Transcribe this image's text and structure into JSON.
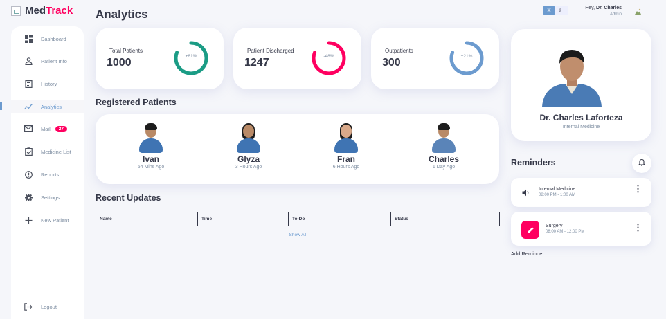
{
  "brand": {
    "prefix": "Med",
    "accent": "Track"
  },
  "page_title": "Analytics",
  "sidebar": {
    "items": [
      {
        "label": "Dashboard",
        "icon": "grid-icon"
      },
      {
        "label": "Patient Info",
        "icon": "person-icon"
      },
      {
        "label": "History",
        "icon": "receipt-icon"
      },
      {
        "label": "Analytics",
        "icon": "insights-icon",
        "active": true
      },
      {
        "label": "Mail",
        "icon": "mail-icon",
        "badge": "27"
      },
      {
        "label": "Medicine List",
        "icon": "inventory-icon"
      },
      {
        "label": "Reports",
        "icon": "report-icon"
      },
      {
        "label": "Settings",
        "icon": "settings-icon"
      },
      {
        "label": "New Patient",
        "icon": "add-icon"
      }
    ],
    "logout": "Logout"
  },
  "stats": [
    {
      "label": "Total Patients",
      "value": "1000",
      "pct_text": "+81%",
      "pct": 0.81,
      "color": "#1b9c85"
    },
    {
      "label": "Patient Discharged",
      "value": "1247",
      "pct_text": "-48%",
      "pct": 0.81,
      "color": "#ff0060"
    },
    {
      "label": "Outpatients",
      "value": "300",
      "pct_text": "+21%",
      "pct": 0.81,
      "color": "#6c9bcf"
    }
  ],
  "registered": {
    "title": "Registered Patients",
    "patients": [
      {
        "name": "Ivan",
        "time": "54 Mins Ago"
      },
      {
        "name": "Glyza",
        "time": "3 Hours Ago"
      },
      {
        "name": "Fran",
        "time": "6 Hours Ago"
      },
      {
        "name": "Charles",
        "time": "1 Day Ago"
      }
    ]
  },
  "recent": {
    "title": "Recent Updates",
    "columns": [
      "Name",
      "Time",
      "To-Do",
      "Status"
    ],
    "show_all": "Show All"
  },
  "header": {
    "greeting": "Hey,",
    "user": "Dr. Charles",
    "role": "Admin"
  },
  "profile": {
    "name": "Dr. Charles Laforteza",
    "specialty": "Internal Medicine"
  },
  "reminders": {
    "title": "Reminders",
    "items": [
      {
        "name": "Internal Medicine",
        "time": "08:00 PM - 1:00 AM"
      },
      {
        "name": "Surgery",
        "time": "08:00 AM - 12:00 PM"
      }
    ],
    "add_label": "Add Reminder"
  },
  "colors": {
    "primary": "#6c9bcf",
    "danger": "#ff0060",
    "success": "#1b9c85",
    "dark": "#363949"
  }
}
